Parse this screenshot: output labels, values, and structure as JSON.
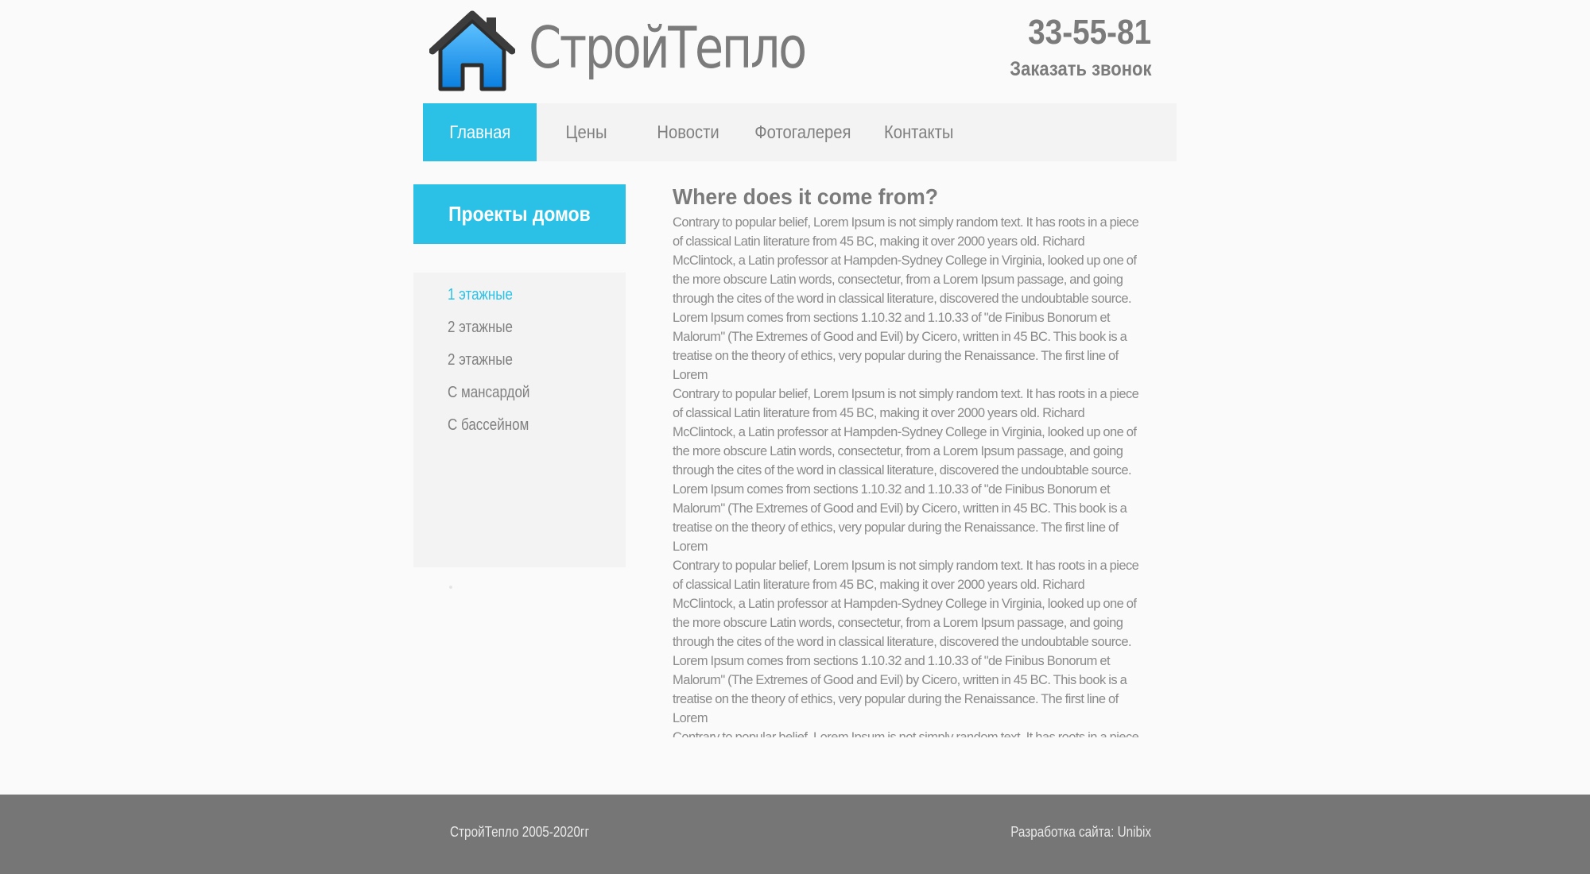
{
  "header": {
    "logo_text": "СтройТепло",
    "phone": "33-55-81",
    "callback_label": "Заказать звонок",
    "accent_color": "#2bc1e6"
  },
  "nav": {
    "items": [
      {
        "label": "Главная",
        "active": true
      },
      {
        "label": "Цены",
        "active": false
      },
      {
        "label": "Новости",
        "active": false
      },
      {
        "label": "Фотогалерея",
        "active": false
      },
      {
        "label": "Контакты",
        "active": false
      }
    ]
  },
  "sidebar": {
    "title": "Проекты домов",
    "items": [
      {
        "label": "1 этажные",
        "active": true
      },
      {
        "label": "2 этажные",
        "active": false
      },
      {
        "label": "2 этажные",
        "active": false
      },
      {
        "label": "С мансардой",
        "active": false
      },
      {
        "label": "С бассейном",
        "active": false
      }
    ]
  },
  "content": {
    "heading": "Where does it come from?",
    "paragraphs": [
      "Contrary to popular belief, Lorem Ipsum is not simply random text. It has roots in a piece of classical Latin literature from 45 BC, making it over 2000 years old. Richard McClintock, a Latin professor at Hampden-Sydney College in Virginia, looked up one of the more obscure Latin words, consectetur, from a Lorem Ipsum passage, and going through the cites of the word in classical literature, discovered the undoubtable source. Lorem Ipsum comes from sections 1.10.32 and 1.10.33 of \"de Finibus Bonorum et Malorum\" (The Extremes of Good and Evil) by Cicero, written in 45 BC. This book is a treatise on the theory of ethics, very popular during the Renaissance. The first line of Lorem",
      "Contrary to popular belief, Lorem Ipsum is not simply random text. It has roots in a piece of classical Latin literature from 45 BC, making it over 2000 years old. Richard McClintock, a Latin professor at Hampden-Sydney College in Virginia, looked up one of the more obscure Latin words, consectetur, from a Lorem Ipsum passage, and going through the cites of the word in classical literature, discovered the undoubtable source. Lorem Ipsum comes from sections 1.10.32 and 1.10.33 of \"de Finibus Bonorum et Malorum\" (The Extremes of Good and Evil) by Cicero, written in 45 BC. This book is a treatise on the theory of ethics, very popular during the Renaissance. The first line of Lorem",
      "Contrary to popular belief, Lorem Ipsum is not simply random text. It has roots in a piece of classical Latin literature from 45 BC, making it over 2000 years old. Richard McClintock, a Latin professor at Hampden-Sydney College in Virginia, looked up one of the more obscure Latin words, consectetur, from a Lorem Ipsum passage, and going through the cites of the word in classical literature, discovered the undoubtable source. Lorem Ipsum comes from sections 1.10.32 and 1.10.33 of \"de Finibus Bonorum et Malorum\" (The Extremes of Good and Evil) by Cicero, written in 45 BC. This book is a treatise on the theory of ethics, very popular during the Renaissance. The first line of Lorem",
      "Contrary to popular belief, Lorem Ipsum is not simply random text. It has roots in a piece of classical Latin literature from 45 BC, making it over 2000 years old. Richard McClintock, a Latin professor at Hampden-Sydney College in Virginia, looked up one of the more obscure Latin words, consectetur, from a Lorem Ipsum passage, and going through the cites of the word in classical literature, discovered the undoubtable source. Lorem Ipsum comes from sections 1.10.32 and 1.10.33 of \"de Finibus Bonorum et Malorum\" (The Extremes of Good and Evil) by Cicero, written in 45 BC. This book is a treatise on the theory of ethics, very popular during the Renaissance. The first line of Lorem"
    ]
  },
  "footer": {
    "copyright": "СтройТепло 2005-2020гг",
    "developer": "Разработка сайта: Unibix"
  }
}
